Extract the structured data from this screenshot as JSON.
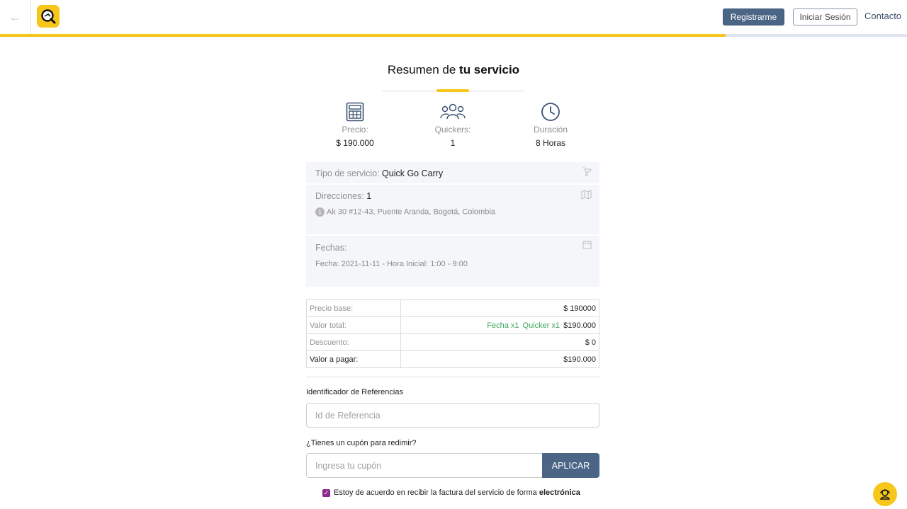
{
  "header": {
    "register_label": "Registrarme",
    "login_label": "Iniciar Sesión",
    "contact_label": "Contacto",
    "progress_fraction": 0.8
  },
  "summary": {
    "title_prefix": "Resumen de",
    "title_bold": "tu servicio",
    "stats": [
      {
        "icon": "calculator-icon",
        "label": "Precio:",
        "value": "$ 190.000"
      },
      {
        "icon": "users-icon",
        "label": "Quickers:",
        "value": "1"
      },
      {
        "icon": "clock-icon",
        "label": "Duración",
        "value": "8 Horas"
      }
    ]
  },
  "details": {
    "service_type_label": "Tipo de servicio:",
    "service_type_value": "Quick Go Carry",
    "addresses_label": "Direcciones:",
    "addresses_count": "1",
    "addresses": [
      {
        "index": "1",
        "text": "Ak 30 #12-43, Puente Aranda, Bogotá, Colombia"
      }
    ],
    "dates_label": "Fechas:",
    "dates": [
      "Fecha: 2021-11-11 - Hora Inicial: 1:00 - 9:00"
    ]
  },
  "prices": {
    "base_label": "Precio base:",
    "base_value": "$ 190000",
    "total_label": "Valor total:",
    "total_tags": [
      "Fecha x1",
      "Quicker x1"
    ],
    "total_value": "$190.000",
    "discount_label": "Descuento:",
    "discount_value": "$ 0",
    "to_pay_label": "Valor a pagar:",
    "to_pay_value": "$190.000"
  },
  "form": {
    "reference_label": "Identificador de Referencias",
    "reference_placeholder": "Id de Referencia",
    "coupon_label": "¿Tienes un cupón para redimir?",
    "coupon_placeholder": "Ingresa tu cupón",
    "apply_label": "APLICAR",
    "consent_text": "Estoy de acuerdo en recibir la factura del servicio de forma",
    "consent_bold": "electrónica",
    "consent_checked": true
  },
  "colors": {
    "accent": "#f7c61a",
    "primary": "#4a6585",
    "tag_green": "#3aa55a"
  }
}
